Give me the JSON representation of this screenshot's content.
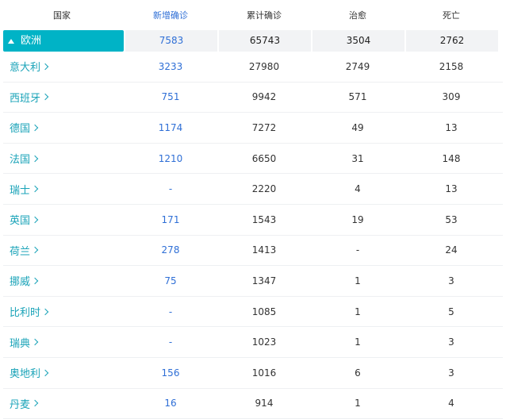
{
  "headers": [
    "国家",
    "新增确诊",
    "累计确诊",
    "治愈",
    "死亡"
  ],
  "region": {
    "name": "欧洲",
    "new": "7583",
    "total": "65743",
    "cured": "3504",
    "dead": "2762"
  },
  "rows": [
    {
      "name": "意大利",
      "new": "3233",
      "total": "27980",
      "cured": "2749",
      "dead": "2158"
    },
    {
      "name": "西班牙",
      "new": "751",
      "total": "9942",
      "cured": "571",
      "dead": "309"
    },
    {
      "name": "德国",
      "new": "1174",
      "total": "7272",
      "cured": "49",
      "dead": "13"
    },
    {
      "name": "法国",
      "new": "1210",
      "total": "6650",
      "cured": "31",
      "dead": "148"
    },
    {
      "name": "瑞士",
      "new": "-",
      "total": "2220",
      "cured": "4",
      "dead": "13"
    },
    {
      "name": "英国",
      "new": "171",
      "total": "1543",
      "cured": "19",
      "dead": "53"
    },
    {
      "name": "荷兰",
      "new": "278",
      "total": "1413",
      "cured": "-",
      "dead": "24"
    },
    {
      "name": "挪威",
      "new": "75",
      "total": "1347",
      "cured": "1",
      "dead": "3"
    },
    {
      "name": "比利时",
      "new": "-",
      "total": "1085",
      "cured": "1",
      "dead": "5"
    },
    {
      "name": "瑞典",
      "new": "-",
      "total": "1023",
      "cured": "1",
      "dead": "3"
    },
    {
      "name": "奥地利",
      "new": "156",
      "total": "1016",
      "cured": "6",
      "dead": "3"
    },
    {
      "name": "丹麦",
      "new": "16",
      "total": "914",
      "cured": "1",
      "dead": "4"
    }
  ],
  "colors": {
    "accent": "#00b3c6",
    "new_case": "#2f6fd6",
    "country": "#1aa3b8"
  }
}
